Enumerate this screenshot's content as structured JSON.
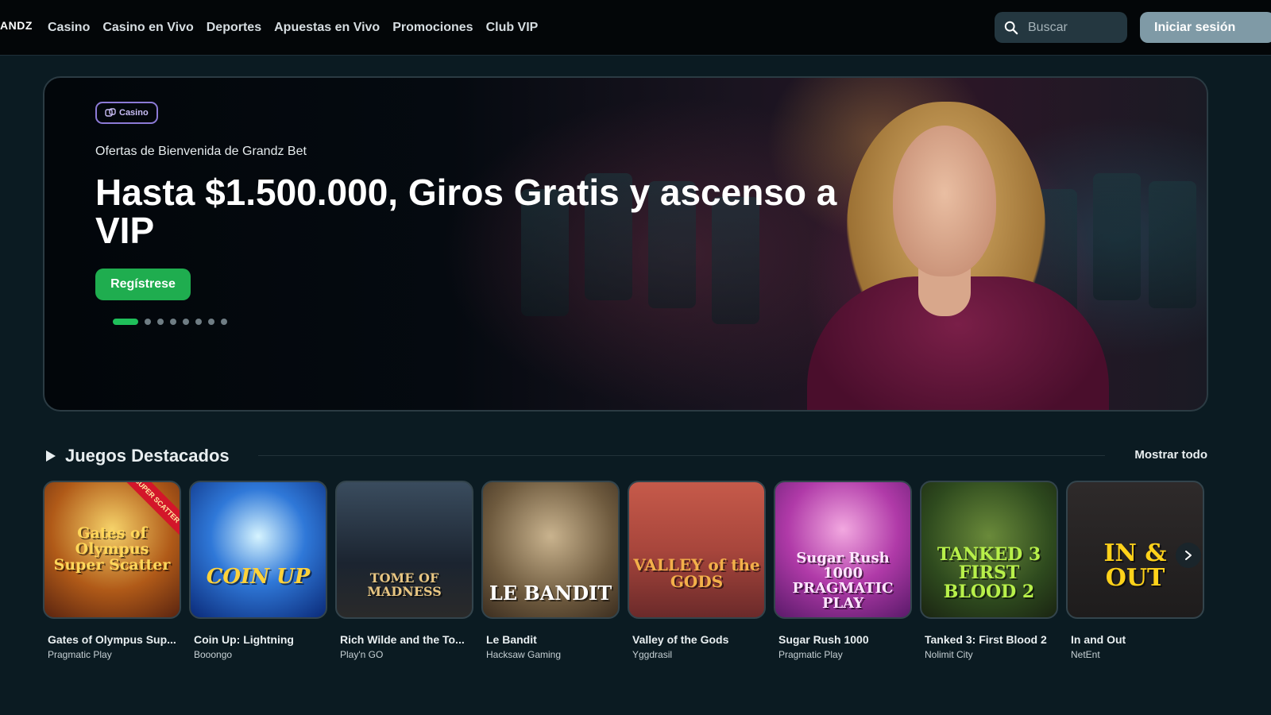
{
  "header": {
    "logo": "ANDZ",
    "nav": [
      "Casino",
      "Casino en Vivo",
      "Deportes",
      "Apuestas en Vivo",
      "Promociones",
      "Club VIP"
    ],
    "search_placeholder": "Buscar",
    "login_label": "Iniciar sesión"
  },
  "hero": {
    "badge": "Casino",
    "subtitle": "Ofertas de Bienvenida de Grandz Bet",
    "title": "Hasta $1.500.000, Giros Gratis y ascenso a VIP",
    "cta": "Regístrese",
    "slide_count": 8,
    "active_slide": 1,
    "accent_color": "#1fad4f"
  },
  "featured": {
    "title": "Juegos Destacados",
    "show_all": "Mostrar todo",
    "games": [
      {
        "name": "Gates of Olympus Sup...",
        "provider": "Pragmatic Play",
        "art": "Gates of Olympus Super Scatter",
        "ribbon": "SUPER SCATTER"
      },
      {
        "name": "Coin Up: Lightning",
        "provider": "Booongo",
        "art": "COIN UP"
      },
      {
        "name": "Rich Wilde and the To...",
        "provider": "Play'n GO",
        "art": "TOME OF MADNESS"
      },
      {
        "name": "Le Bandit",
        "provider": "Hacksaw Gaming",
        "art": "LE BANDIT"
      },
      {
        "name": "Valley of the Gods",
        "provider": "Yggdrasil",
        "art": "VALLEY of the GODS"
      },
      {
        "name": "Sugar Rush 1000",
        "provider": "Pragmatic Play",
        "art": "Sugar Rush 1000 PRAGMATIC PLAY"
      },
      {
        "name": "Tanked 3: First Blood 2",
        "provider": "Nolimit City",
        "art": "TANKED 3 FIRST BLOOD 2"
      },
      {
        "name": "In and Out",
        "provider": "NetEnt",
        "art": "IN & OUT"
      }
    ]
  }
}
